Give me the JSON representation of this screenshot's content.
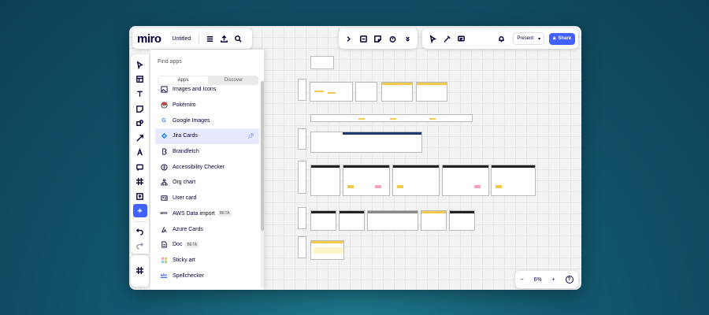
{
  "app": {
    "logo": "miro",
    "board_title": "Untitled"
  },
  "top_right": {
    "present_label": "Present",
    "share_label": "Share"
  },
  "apps_panel": {
    "header": "Find apps",
    "tabs": [
      "Apps",
      "Discover"
    ],
    "items": [
      {
        "label": "Images and Icons",
        "icon": "images-icon",
        "beta": ""
      },
      {
        "label": "Pokémiro",
        "icon": "pokeball-icon",
        "beta": ""
      },
      {
        "label": "Google Images",
        "icon": "google-icon",
        "beta": ""
      },
      {
        "label": "Jira Cards",
        "icon": "jira-icon",
        "beta": ""
      },
      {
        "label": "Brandfetch",
        "icon": "brandfetch-icon",
        "beta": ""
      },
      {
        "label": "Accessibility Checker",
        "icon": "accessibility-icon",
        "beta": ""
      },
      {
        "label": "Org chart",
        "icon": "org-chart-icon",
        "beta": ""
      },
      {
        "label": "User card",
        "icon": "user-card-icon",
        "beta": ""
      },
      {
        "label": "AWS Data import",
        "icon": "aws-icon",
        "beta": "BETA"
      },
      {
        "label": "Azure Cards",
        "icon": "azure-icon",
        "beta": ""
      },
      {
        "label": "Doc",
        "icon": "doc-icon",
        "beta": "BETA"
      },
      {
        "label": "Sticky art",
        "icon": "sticky-art-icon",
        "beta": ""
      },
      {
        "label": "Spellchecker",
        "icon": "spellchecker-icon",
        "beta": ""
      }
    ],
    "pinned_index": 3
  },
  "zoom": {
    "minus": "−",
    "level": "6%",
    "plus": "+",
    "help": "?"
  },
  "colors": {
    "accent": "#4262ff",
    "brand_text": "#050038",
    "sticky_yellow": "#f2c94c"
  }
}
